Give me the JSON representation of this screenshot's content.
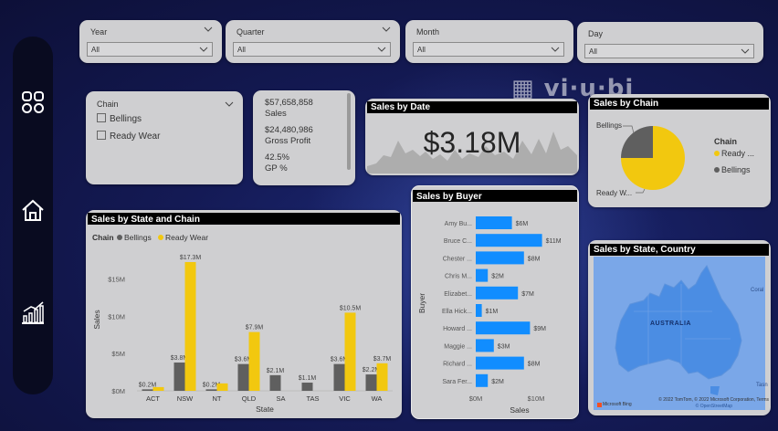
{
  "slicers": {
    "year": {
      "label": "Year",
      "value": "All"
    },
    "quarter": {
      "label": "Quarter",
      "value": "All"
    },
    "month": {
      "label": "Month",
      "value": "All"
    },
    "day": {
      "label": "Day",
      "value": "All"
    }
  },
  "chain_slicer": {
    "label": "Chain",
    "options": [
      "Bellings",
      "Ready Wear"
    ]
  },
  "kpis": {
    "sales_value": "$57,658,858",
    "sales_label": "Sales",
    "gp_value": "$24,480,986",
    "gp_label": "Gross Profit",
    "gp_pct_value": "42.5%",
    "gp_pct_label": "GP %"
  },
  "sales_by_date": {
    "title": "Sales by Date",
    "value": "$3.18M"
  },
  "sales_by_chain": {
    "title": "Sales by Chain",
    "legend_title": "Chain",
    "legend": [
      "Ready ...",
      "Bellings"
    ],
    "labels": [
      "Bellings",
      "Ready W..."
    ]
  },
  "map": {
    "title": "Sales by State, Country",
    "country_label": "AUSTRALIA",
    "sea_label_1": "Coral",
    "sea_label_2": "Tasn",
    "attribution": "© 2022 TomTom, © 2022 Microsoft Corporation, Terms",
    "attribution2": "© OpenStreetMap",
    "bing": "Microsoft Bing"
  },
  "colors": {
    "bellings": "#5f5f5f",
    "ready_wear": "#f2c80f",
    "buyer_bar": "#118dff"
  },
  "chart_data": [
    {
      "type": "bar",
      "title": "Sales by State and Chain",
      "legend_title": "Chain",
      "xlabel": "State",
      "ylabel": "Sales",
      "ylim": [
        0,
        17300000
      ],
      "yticks": [
        "$0M",
        "$5M",
        "$10M",
        "$15M"
      ],
      "categories": [
        "ACT",
        "NSW",
        "NT",
        "QLD",
        "SA",
        "TAS",
        "VIC",
        "WA"
      ],
      "series": [
        {
          "name": "Bellings",
          "values": [
            0.2,
            3.8,
            0.2,
            3.6,
            2.1,
            1.1,
            3.6,
            2.2
          ],
          "labels": [
            "$0.2M",
            "$3.8M",
            "$0.2M",
            "$3.6M",
            "$2.1M",
            "$1.1M",
            "$3.6M",
            "$2.2M"
          ]
        },
        {
          "name": "Ready Wear",
          "values": [
            0.5,
            17.3,
            1.0,
            7.9,
            0,
            0,
            10.5,
            3.7
          ],
          "labels": [
            "",
            "$17.3M",
            "",
            "$7.9M",
            "",
            "",
            "$10.5M",
            "$3.7M"
          ]
        }
      ]
    },
    {
      "type": "bar",
      "title": "Sales by Buyer",
      "xlabel": "Sales",
      "ylabel": "Buyer",
      "xticks": [
        "$0M",
        "$10M"
      ],
      "categories": [
        "Amy Bu...",
        "Bruce C...",
        "Chester ...",
        "Chris M...",
        "Elizabet...",
        "Ella Hick...",
        "Howard ...",
        "Maggie ...",
        "Richard ...",
        "Sara Fer..."
      ],
      "values": [
        6,
        11,
        8,
        2,
        7,
        1,
        9,
        3,
        8,
        2
      ],
      "labels": [
        "$6M",
        "$11M",
        "$8M",
        "$2M",
        "$7M",
        "$1M",
        "$9M",
        "$3M",
        "$8M",
        "$2M"
      ]
    },
    {
      "type": "pie",
      "title": "Sales by Chain",
      "categories": [
        "Ready Wear",
        "Bellings"
      ],
      "values": [
        75,
        25
      ]
    }
  ]
}
